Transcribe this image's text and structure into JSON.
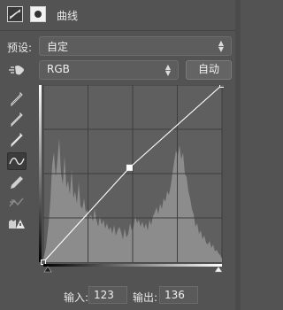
{
  "panel": {
    "title": "曲线"
  },
  "preset": {
    "label": "预设:",
    "value": "自定"
  },
  "channel": {
    "value": "RGB"
  },
  "buttons": {
    "auto_label": "自动"
  },
  "tools": [
    {
      "name": "on-image-adjust-icon"
    },
    {
      "name": "black-point-eyedropper-icon"
    },
    {
      "name": "gray-point-eyedropper-icon"
    },
    {
      "name": "white-point-eyedropper-icon"
    },
    {
      "name": "curve-point-icon",
      "selected": true
    },
    {
      "name": "pencil-draw-icon"
    },
    {
      "name": "smooth-curve-icon"
    },
    {
      "name": "clipping-warning-icon"
    }
  ],
  "curve": {
    "points": [
      [
        0,
        0
      ],
      [
        123,
        136
      ],
      [
        255,
        255
      ]
    ],
    "selected_point": 1
  },
  "io": {
    "input_label": "输入:",
    "input_value": "123",
    "output_label": "输出:",
    "output_value": "136"
  },
  "colors": {
    "panel_bg": "#535353",
    "graph_bg": "#5f5f5f",
    "histogram": "#8c8c8c",
    "curve": "#ffffff"
  }
}
